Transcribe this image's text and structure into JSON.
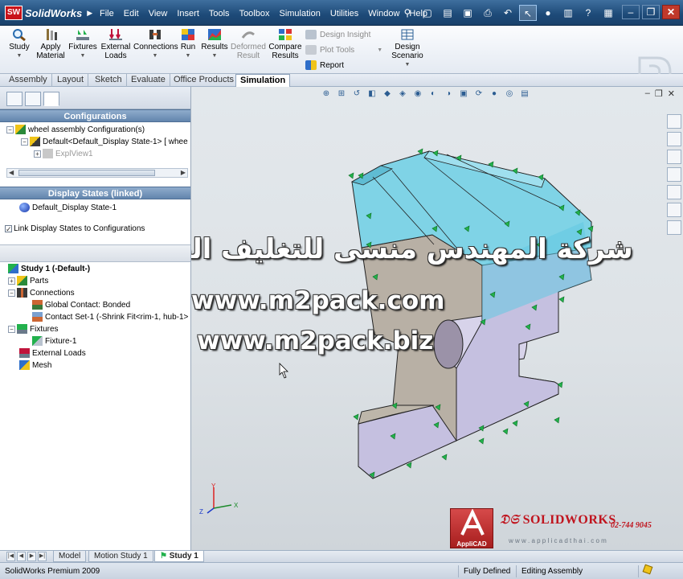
{
  "app": {
    "name": "SolidWorks",
    "menus": [
      "File",
      "Edit",
      "View",
      "Insert",
      "Tools",
      "Toolbox",
      "Simulation",
      "Utilities",
      "Window",
      "Help"
    ]
  },
  "ribbon": {
    "study": "Study",
    "apply_material": [
      "Apply",
      "Material"
    ],
    "fixtures": "Fixtures",
    "external_loads": [
      "External",
      "Loads"
    ],
    "connections": "Connections",
    "run": "Run",
    "results": "Results",
    "deformed_result": [
      "Deformed",
      "Result"
    ],
    "compare_results": [
      "Compare",
      "Results"
    ],
    "design_insight": "Design Insight",
    "plot_tools": "Plot Tools",
    "report": "Report",
    "design_scenario": [
      "Design",
      "Scenario"
    ]
  },
  "command_tabs": [
    "Assembly",
    "Layout",
    "Sketch",
    "Evaluate",
    "Office Products",
    "Simulation"
  ],
  "active_command_tab": "Simulation",
  "configurations": {
    "header": "Configurations",
    "root": "wheel assembly Configuration(s)",
    "config": "Default<Default_Display State-1> [ whee",
    "explview": "ExplView1"
  },
  "display_states": {
    "header": "Display States (linked)",
    "state": "Default_Display State-1",
    "link_checkbox": "Link Display States to Configurations",
    "link_checked": true
  },
  "study_tree": {
    "study": "Study 1 (-Default-)",
    "parts": "Parts",
    "connections": "Connections",
    "global_contact": "Global Contact: Bonded",
    "contact_set": "Contact Set-1 (-Shrink Fit<rim-1, hub-1>",
    "fixtures": "Fixtures",
    "fixture1": "Fixture-1",
    "external_loads": "External Loads",
    "mesh": "Mesh"
  },
  "watermark": {
    "arabic": "شركة المهندس منسى للتغليف الحديث",
    "url1": "www.m2pack.com",
    "url2": "www.m2pack.biz"
  },
  "branding": {
    "applicad": "AppliCAD",
    "solidworks": "SOLIDWORKS",
    "phone": "02-744 9045",
    "website": "w w w . a p p l i c a d t h a i . c o m"
  },
  "triad": {
    "x": "X",
    "y": "Y",
    "z": "Z"
  },
  "bottom_tabs": [
    "Model",
    "Motion Study 1",
    "Study 1"
  ],
  "active_bottom_tab": "Study 1",
  "status": {
    "product": "SolidWorks Premium 2009",
    "state": "Fully Defined",
    "mode": "Editing Assembly"
  },
  "colors": {
    "title_bar": "#1d4a78",
    "panel_header": "#6285ad",
    "rim_face": "#7fd3e6",
    "hub_face": "#b9b1a6",
    "side_face": "#c7c2e2",
    "fixture_arrow": "#22b14c"
  }
}
